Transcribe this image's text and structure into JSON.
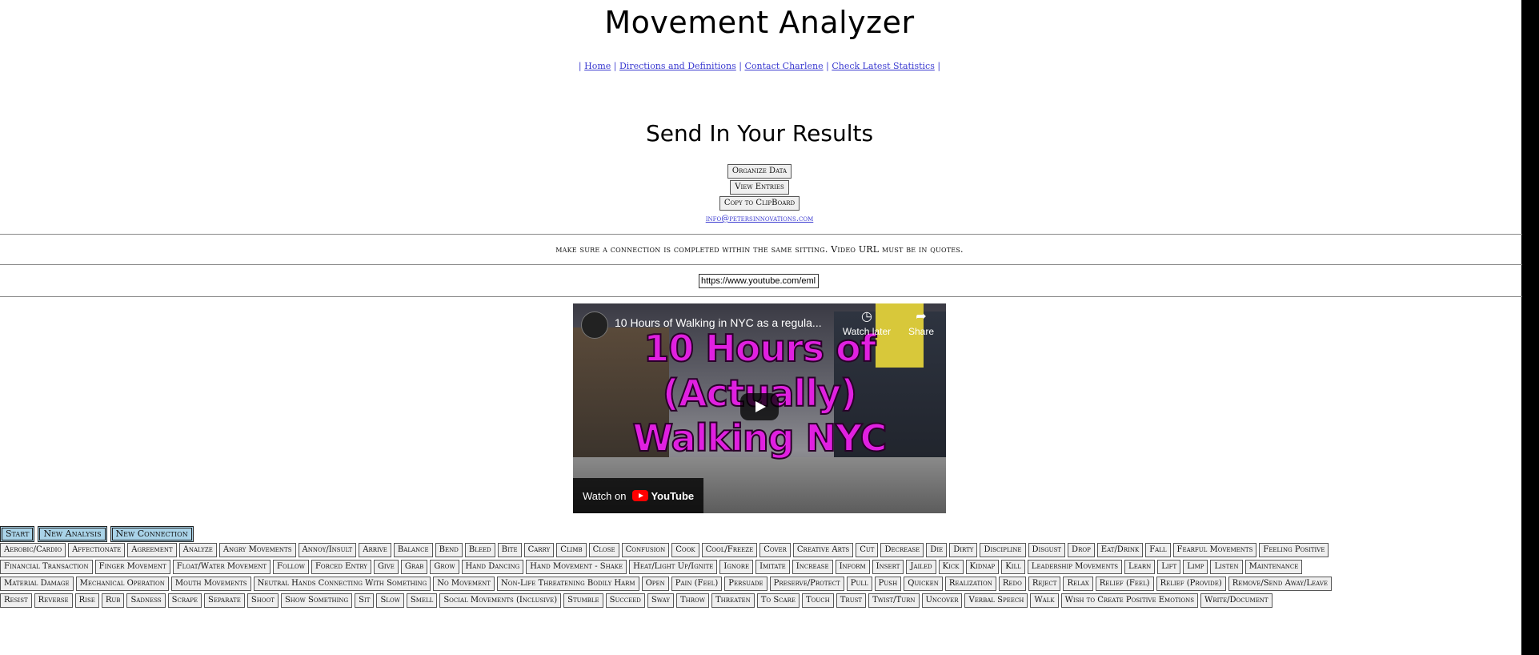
{
  "page": {
    "title": "Movement Analyzer",
    "subtitle": "Send In Your Results"
  },
  "nav": {
    "items": [
      "Home",
      "Directions and Definitions",
      "Contact Charlene",
      "Check Latest Statistics"
    ]
  },
  "actions": {
    "organize": "Organize Data",
    "view": "View Entries",
    "copy": "Copy to ClipBoard"
  },
  "contact_email": "info@petersinnovations.com",
  "notice": "make sure a connection is completed within the same sitting. Video URL must be in quotes.",
  "url_input": {
    "value": "https://www.youtube.com/eml"
  },
  "video": {
    "title": "10 Hours of Walking in NYC as a regula...",
    "thumbnail_text": [
      "10 Hours of",
      "(Actually)",
      "Walking NYC"
    ],
    "watch_later": "Watch later",
    "share": "Share",
    "watch_on": "Watch on",
    "youtube": "YouTube"
  },
  "controls": {
    "start": "Start",
    "new_analysis": "New Analysis",
    "new_connection": "New Connection"
  },
  "movements": {
    "row1": [
      "Aerobic/Cardio",
      "Affectionate",
      "Agreement",
      "Analyze",
      "Angry Movements",
      "Annoy/Insult",
      "Arrive",
      "Balance",
      "Bend",
      "Bleed",
      "Bite",
      "Carry",
      "Climb",
      "Close",
      "Confusion",
      "Cook",
      "Cool/Freeze",
      "Cover",
      "Creative Arts",
      "Cut",
      "Decrease",
      "Die",
      "Dirty",
      "Discipline",
      "Disgust",
      "Drop",
      "Eat/Drink",
      "Fall",
      "Fearful Movements",
      "Feeling Positive"
    ],
    "row2": [
      "Financial Transaction",
      "Finger Movement",
      "Float/Water Movement",
      "Follow",
      "Forced Entry",
      "Give",
      "Grab",
      "Grow",
      "Hand Dancing",
      "Hand Movement - Shake",
      "Heat/Light Up/Ignite",
      "Ignore",
      "Imitate",
      "Increase",
      "Inform",
      "Insert",
      "Jailed",
      "Kick",
      "Kidnap",
      "Kill",
      "Leadership Movements",
      "Learn",
      "Lift",
      "Limp",
      "Listen",
      "Maintenance"
    ],
    "row3": [
      "Material Damage",
      "Mechanical Operation",
      "Mouth Movements",
      "Neutral Hands Connecting With Something",
      "No Movement",
      "Non-Life Threatening Bodily Harm",
      "Open",
      "Pain (Feel)",
      "Persuade",
      "Preserve/Protect",
      "Pull",
      "Push",
      "Quicken",
      "Realization",
      "Redo",
      "Reject",
      "Relax",
      "Relief (Feel)",
      "Relief (Provide)",
      "Remove/Send Away/Leave"
    ],
    "row4": [
      "Resist",
      "Reverse",
      "Rise",
      "Rub",
      "Sadness",
      "Scrape",
      "Separate",
      "Shoot",
      "Show Something",
      "Sit",
      "Slow",
      "Smell",
      "Social Movements (Inclusive)",
      "Stumble",
      "Succeed",
      "Sway",
      "Throw",
      "Threaten",
      "To Scare",
      "Touch",
      "Trust",
      "Twist/Turn",
      "Uncover",
      "Verbal Speech",
      "Walk",
      "Wish to Create Positive Emotions",
      "Write/Document"
    ]
  },
  "colors": {
    "link": "#3a3ad0",
    "control_button": "#a9d3e8",
    "thumbnail_text": "#e020e0"
  }
}
